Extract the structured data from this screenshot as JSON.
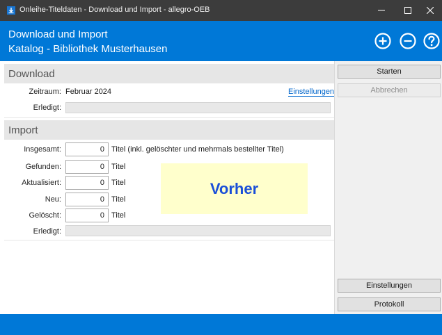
{
  "window": {
    "title": "Onleihe-Titeldaten - Download und Import - allegro-OEB",
    "controls": {
      "minimize": "–",
      "maximize": "☐",
      "close": "✕"
    }
  },
  "header": {
    "title": "Download und Import",
    "subtitle": "Katalog - Bibliothek Musterhausen",
    "icons": [
      "plus-circle-icon",
      "minus-circle-icon",
      "help-circle-icon"
    ]
  },
  "download": {
    "heading": "Download",
    "zeitraum_label": "Zeitraum:",
    "zeitraum_value": "Februar 2024",
    "settings_link": "Einstellungen",
    "erledigt_label": "Erledigt:",
    "progress": 0
  },
  "import": {
    "heading": "Import",
    "rows": [
      {
        "label": "Insgesamt:",
        "value": "0",
        "unit": "Titel (inkl. gelöschter und mehrmals bestellter Titel)"
      },
      {
        "label": "Gefunden:",
        "value": "0",
        "unit": "Titel"
      },
      {
        "label": "Aktualisiert:",
        "value": "0",
        "unit": "Titel"
      },
      {
        "label": "Neu:",
        "value": "0",
        "unit": "Titel"
      },
      {
        "label": "Gelöscht:",
        "value": "0",
        "unit": "Titel"
      }
    ],
    "erledigt_label": "Erledigt:",
    "progress": 0
  },
  "note": {
    "text": "Vorher"
  },
  "sidebar": {
    "start": "Starten",
    "cancel": "Abbrechen",
    "settings": "Einstellungen",
    "log": "Protokoll"
  },
  "colors": {
    "accent": "#0078d7",
    "titlebar": "#3c3c3c",
    "note_bg": "#ffffcc",
    "note_text": "#1a4fd8",
    "link": "#0066cc"
  }
}
